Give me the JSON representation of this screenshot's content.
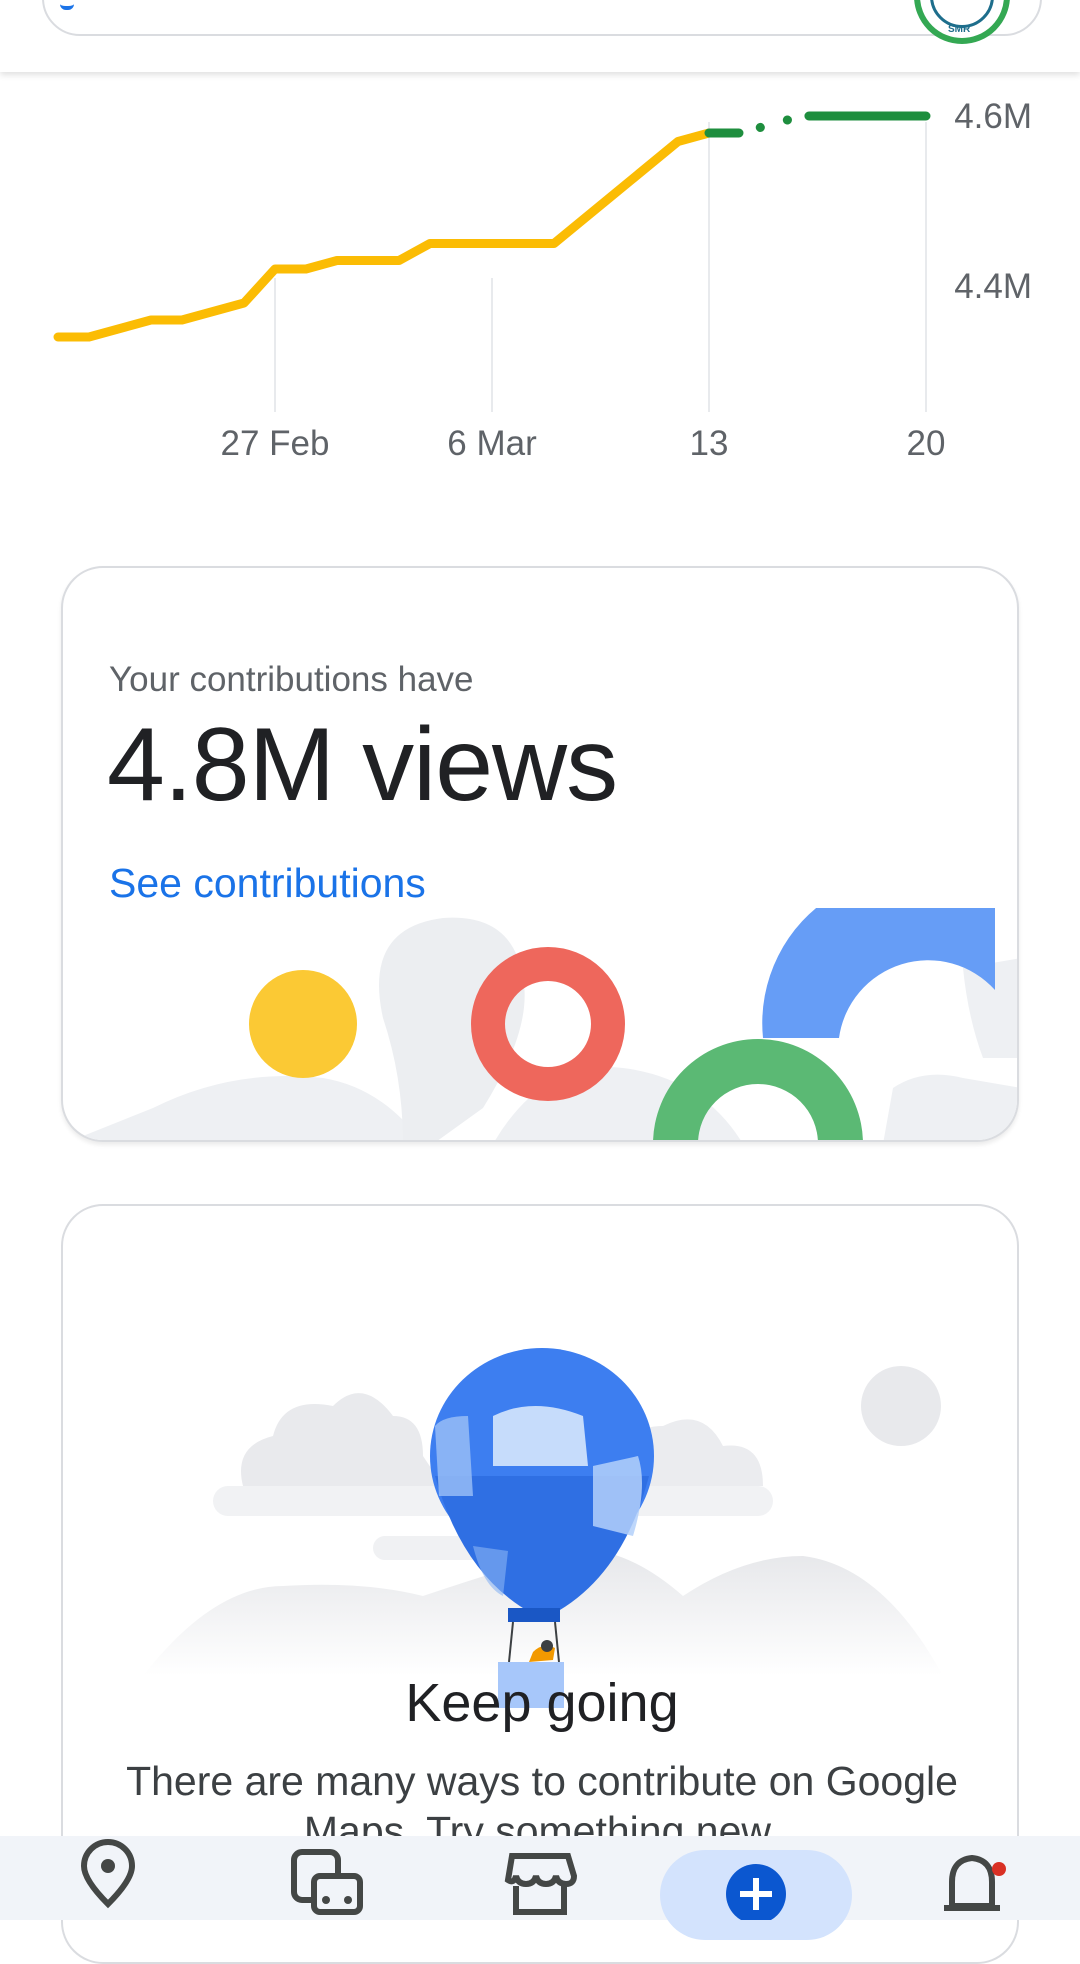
{
  "header": {
    "search_icon": "search-icon",
    "avatar_text": "SMR"
  },
  "chart_data": {
    "type": "line",
    "x_tick_labels": [
      "27 Feb",
      "6 Mar",
      "13",
      "20"
    ],
    "y_tick_labels": [
      "4.4M",
      "4.6M"
    ],
    "series": [
      {
        "style": "solid",
        "color": "#FBBC04",
        "points": [
          {
            "x": "20 Feb",
            "y": 4.34
          },
          {
            "x": "21 Feb",
            "y": 4.34
          },
          {
            "x": "23 Feb",
            "y": 4.36
          },
          {
            "x": "24 Feb",
            "y": 4.36
          },
          {
            "x": "25 Feb",
            "y": 4.37
          },
          {
            "x": "26 Feb",
            "y": 4.38
          },
          {
            "x": "27 Feb",
            "y": 4.42
          },
          {
            "x": "28 Feb",
            "y": 4.42
          },
          {
            "x": "1 Mar",
            "y": 4.43
          },
          {
            "x": "3 Mar",
            "y": 4.43
          },
          {
            "x": "4 Mar",
            "y": 4.45
          },
          {
            "x": "8 Mar",
            "y": 4.45
          },
          {
            "x": "12 Mar",
            "y": 4.57
          },
          {
            "x": "13 Mar",
            "y": 4.58
          }
        ]
      },
      {
        "style": "dotted",
        "color": "#1E8E3E",
        "points": [
          {
            "x": "13 Mar",
            "y": 4.58
          },
          {
            "x": "14 Mar",
            "y": 4.58
          },
          {
            "x": "15 Mar",
            "y": 4.59
          },
          {
            "x": "16 Mar",
            "y": 4.6
          },
          {
            "x": "17 Mar",
            "y": 4.6
          },
          {
            "x": "20 Mar",
            "y": 4.6
          }
        ]
      }
    ]
  },
  "card1": {
    "subtitle": "Your contributions have",
    "headline": "4.8M views",
    "link": "See contributions"
  },
  "card2": {
    "title": "Keep going",
    "body": "There are many ways to contribute on Google Maps. Try something new."
  },
  "nav": {
    "items": [
      {
        "icon": "map-pin-icon"
      },
      {
        "icon": "transit-icon"
      },
      {
        "icon": "store-icon"
      },
      {
        "icon": "contribute-icon",
        "active": true
      },
      {
        "icon": "notifications-icon",
        "badge": true
      }
    ]
  },
  "colors": {
    "accent": "#1a73e8",
    "yellow": "#FBBC04",
    "green": "#1E8E3E",
    "red": "#EA4335",
    "active_pill": "#d3e3fd"
  }
}
